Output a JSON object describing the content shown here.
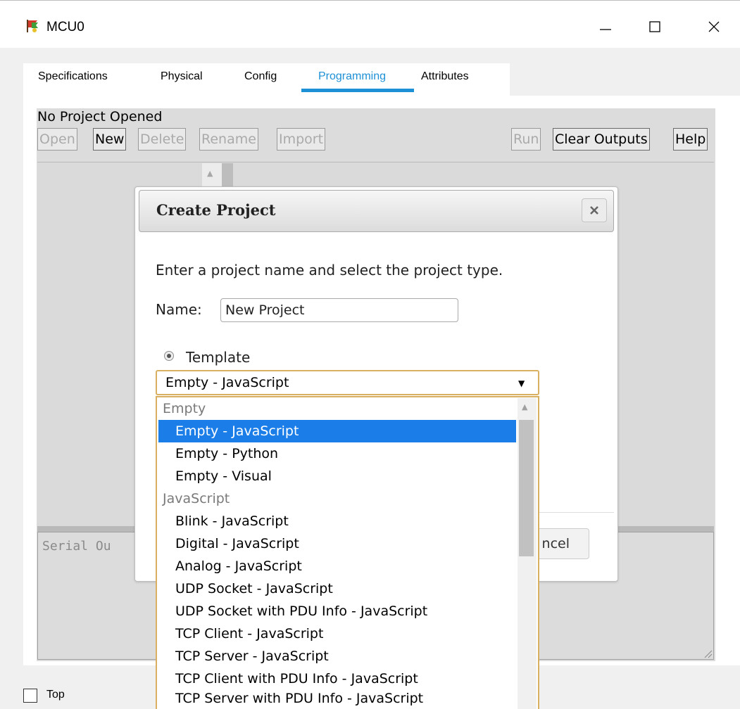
{
  "window": {
    "title": "MCU0",
    "icon": "mcu-device-icon"
  },
  "tabs": [
    {
      "label": "Specifications"
    },
    {
      "label": "Physical"
    },
    {
      "label": "Config"
    },
    {
      "label": "Programming",
      "active": true
    },
    {
      "label": "Attributes"
    }
  ],
  "programming": {
    "status": "No Project Opened",
    "toolbar": {
      "open": "Open",
      "new": "New",
      "delete": "Delete",
      "rename": "Rename",
      "import": "Import",
      "run": "Run",
      "clear_outputs": "Clear Outputs",
      "help": "Help"
    },
    "serial_output_placeholder": "Serial Ou"
  },
  "dialog": {
    "title": "Create Project",
    "prompt": "Enter a project name and select the project type.",
    "name_label": "Name:",
    "name_value": "New Project",
    "template_label": "Template",
    "template_selected": "Empty - JavaScript",
    "cancel_label": "ncel"
  },
  "dropdown_options": [
    {
      "label": "Empty",
      "group": true
    },
    {
      "label": "Empty - JavaScript",
      "selected": true
    },
    {
      "label": "Empty - Python"
    },
    {
      "label": "Empty - Visual"
    },
    {
      "label": "JavaScript",
      "group": true
    },
    {
      "label": "Blink - JavaScript"
    },
    {
      "label": "Digital - JavaScript"
    },
    {
      "label": "Analog - JavaScript"
    },
    {
      "label": "UDP Socket - JavaScript"
    },
    {
      "label": "UDP Socket with PDU Info - JavaScript"
    },
    {
      "label": "TCP Client - JavaScript"
    },
    {
      "label": "TCP Server - JavaScript"
    },
    {
      "label": "TCP Client with PDU Info - JavaScript"
    },
    {
      "label": "TCP Server with PDU Info - JavaScript"
    }
  ],
  "footer": {
    "top_label": "Top"
  },
  "colors": {
    "accent": "#1e90d6",
    "selection": "#1a7de8",
    "focus_border": "#d9b062"
  }
}
